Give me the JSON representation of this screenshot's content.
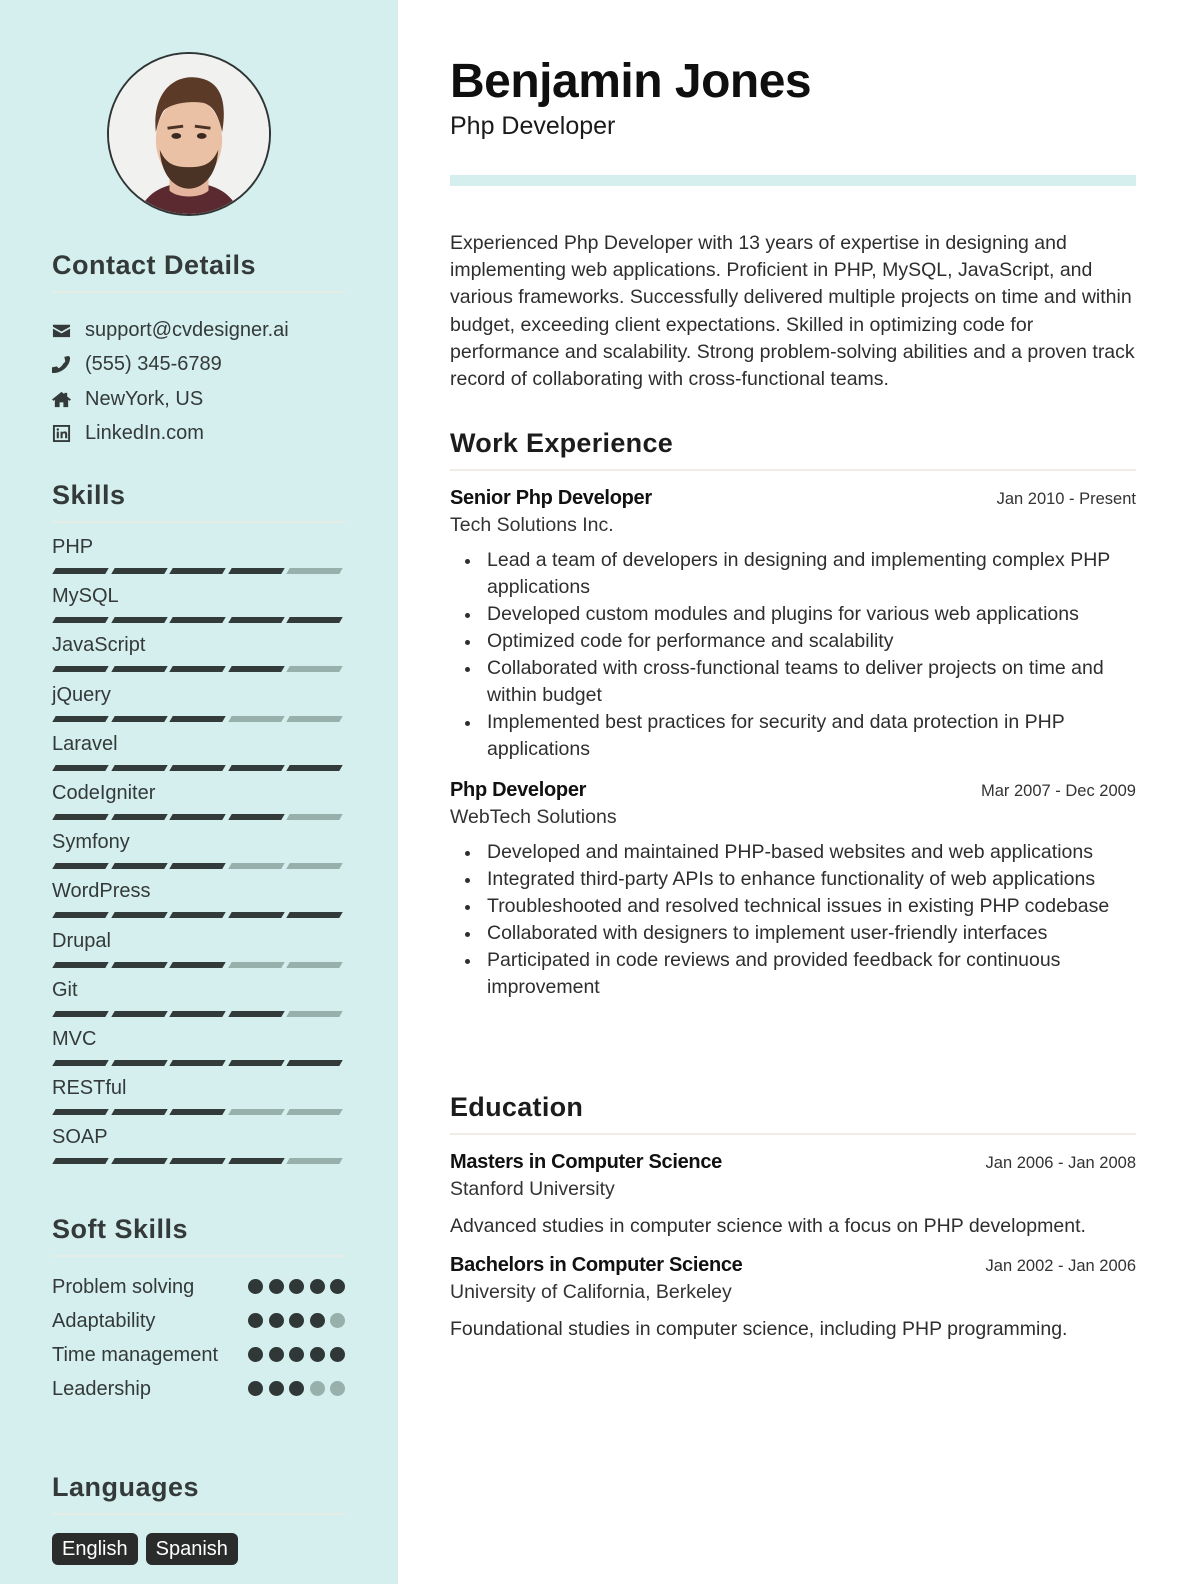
{
  "profile": {
    "name": "Benjamin Jones",
    "title": "Php Developer",
    "photo_icon": "person-photo",
    "summary": "Experienced Php Developer with 13 years of expertise in designing and implementing web applications. Proficient in PHP, MySQL, JavaScript, and various frameworks. Successfully delivered multiple projects on time and within budget, exceeding client expectations. Skilled in optimizing code for performance and scalability. Strong problem-solving abilities and a proven track record of collaborating with cross-functional teams."
  },
  "colors": {
    "sidebar_bg": "#d4efed",
    "accent": "#d4efed",
    "filled": "#333a3a",
    "empty": "#97b0ab",
    "badge_bg": "#2a2b2b"
  },
  "contact": {
    "heading": "Contact Details",
    "items": [
      {
        "icon": "envelope-icon",
        "text": "support@cvdesigner.ai"
      },
      {
        "icon": "phone-icon",
        "text": "(555) 345-6789"
      },
      {
        "icon": "home-icon",
        "text": "NewYork, US"
      },
      {
        "icon": "linkedin-icon",
        "text": "LinkedIn.com"
      }
    ]
  },
  "skills": {
    "heading": "Skills",
    "max": 5,
    "items": [
      {
        "name": "PHP",
        "level": 4
      },
      {
        "name": "MySQL",
        "level": 5
      },
      {
        "name": "JavaScript",
        "level": 4
      },
      {
        "name": "jQuery",
        "level": 3
      },
      {
        "name": "Laravel",
        "level": 5
      },
      {
        "name": "CodeIgniter",
        "level": 4
      },
      {
        "name": "Symfony",
        "level": 3
      },
      {
        "name": "WordPress",
        "level": 5
      },
      {
        "name": "Drupal",
        "level": 3
      },
      {
        "name": "Git",
        "level": 4
      },
      {
        "name": "MVC",
        "level": 5
      },
      {
        "name": "RESTful",
        "level": 3
      },
      {
        "name": "SOAP",
        "level": 4
      }
    ]
  },
  "soft_skills": {
    "heading": "Soft Skills",
    "max": 5,
    "items": [
      {
        "name": "Problem solving",
        "level": 5
      },
      {
        "name": "Adaptability",
        "level": 4
      },
      {
        "name": "Time management",
        "level": 5
      },
      {
        "name": "Leadership",
        "level": 3
      }
    ]
  },
  "languages": {
    "heading": "Languages",
    "items": [
      "English",
      "Spanish"
    ]
  },
  "work": {
    "heading": "Work Experience",
    "entries": [
      {
        "role": "Senior Php Developer",
        "company": "Tech Solutions Inc.",
        "dates": "Jan 2010 - Present",
        "bullets": [
          "Lead a team of developers in designing and implementing complex PHP applications",
          "Developed custom modules and plugins for various web applications",
          "Optimized code for performance and scalability",
          "Collaborated with cross-functional teams to deliver projects on time and within budget",
          "Implemented best practices for security and data protection in PHP applications"
        ]
      },
      {
        "role": "Php Developer",
        "company": "WebTech Solutions",
        "dates": "Mar 2007 - Dec 2009",
        "bullets": [
          "Developed and maintained PHP-based websites and web applications",
          "Integrated third-party APIs to enhance functionality of web applications",
          "Troubleshooted and resolved technical issues in existing PHP codebase",
          "Collaborated with designers to implement user-friendly interfaces",
          "Participated in code reviews and provided feedback for continuous improvement"
        ]
      }
    ]
  },
  "education": {
    "heading": "Education",
    "entries": [
      {
        "degree": "Masters in Computer Science",
        "school": "Stanford University",
        "dates": "Jan 2006 - Jan 2008",
        "description": "Advanced studies in computer science with a focus on PHP development."
      },
      {
        "degree": "Bachelors in Computer Science",
        "school": "University of California, Berkeley",
        "dates": "Jan 2002 - Jan 2006",
        "description": "Foundational studies in computer science, including PHP programming."
      }
    ]
  }
}
